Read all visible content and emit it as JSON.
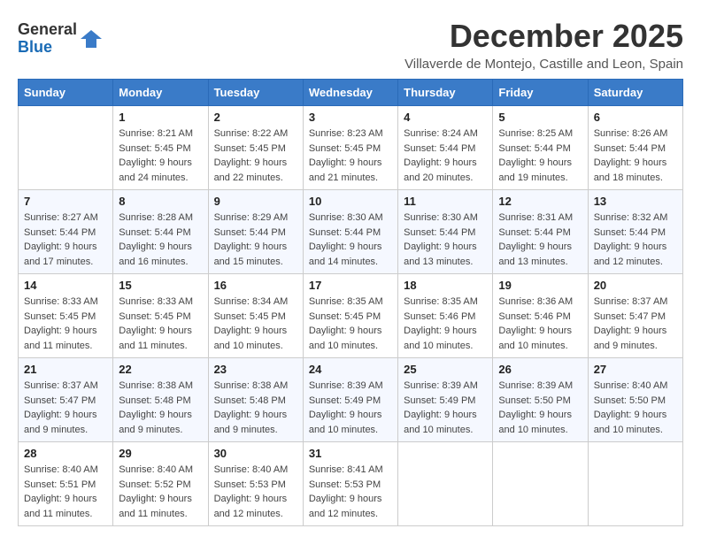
{
  "logo": {
    "general": "General",
    "blue": "Blue"
  },
  "title": "December 2025",
  "location": "Villaverde de Montejo, Castille and Leon, Spain",
  "weekdays": [
    "Sunday",
    "Monday",
    "Tuesday",
    "Wednesday",
    "Thursday",
    "Friday",
    "Saturday"
  ],
  "weeks": [
    [
      {
        "day": "",
        "sunrise": "",
        "sunset": "",
        "daylight": ""
      },
      {
        "day": "1",
        "sunrise": "Sunrise: 8:21 AM",
        "sunset": "Sunset: 5:45 PM",
        "daylight": "Daylight: 9 hours and 24 minutes."
      },
      {
        "day": "2",
        "sunrise": "Sunrise: 8:22 AM",
        "sunset": "Sunset: 5:45 PM",
        "daylight": "Daylight: 9 hours and 22 minutes."
      },
      {
        "day": "3",
        "sunrise": "Sunrise: 8:23 AM",
        "sunset": "Sunset: 5:45 PM",
        "daylight": "Daylight: 9 hours and 21 minutes."
      },
      {
        "day": "4",
        "sunrise": "Sunrise: 8:24 AM",
        "sunset": "Sunset: 5:44 PM",
        "daylight": "Daylight: 9 hours and 20 minutes."
      },
      {
        "day": "5",
        "sunrise": "Sunrise: 8:25 AM",
        "sunset": "Sunset: 5:44 PM",
        "daylight": "Daylight: 9 hours and 19 minutes."
      },
      {
        "day": "6",
        "sunrise": "Sunrise: 8:26 AM",
        "sunset": "Sunset: 5:44 PM",
        "daylight": "Daylight: 9 hours and 18 minutes."
      }
    ],
    [
      {
        "day": "7",
        "sunrise": "Sunrise: 8:27 AM",
        "sunset": "Sunset: 5:44 PM",
        "daylight": "Daylight: 9 hours and 17 minutes."
      },
      {
        "day": "8",
        "sunrise": "Sunrise: 8:28 AM",
        "sunset": "Sunset: 5:44 PM",
        "daylight": "Daylight: 9 hours and 16 minutes."
      },
      {
        "day": "9",
        "sunrise": "Sunrise: 8:29 AM",
        "sunset": "Sunset: 5:44 PM",
        "daylight": "Daylight: 9 hours and 15 minutes."
      },
      {
        "day": "10",
        "sunrise": "Sunrise: 8:30 AM",
        "sunset": "Sunset: 5:44 PM",
        "daylight": "Daylight: 9 hours and 14 minutes."
      },
      {
        "day": "11",
        "sunrise": "Sunrise: 8:30 AM",
        "sunset": "Sunset: 5:44 PM",
        "daylight": "Daylight: 9 hours and 13 minutes."
      },
      {
        "day": "12",
        "sunrise": "Sunrise: 8:31 AM",
        "sunset": "Sunset: 5:44 PM",
        "daylight": "Daylight: 9 hours and 13 minutes."
      },
      {
        "day": "13",
        "sunrise": "Sunrise: 8:32 AM",
        "sunset": "Sunset: 5:44 PM",
        "daylight": "Daylight: 9 hours and 12 minutes."
      }
    ],
    [
      {
        "day": "14",
        "sunrise": "Sunrise: 8:33 AM",
        "sunset": "Sunset: 5:45 PM",
        "daylight": "Daylight: 9 hours and 11 minutes."
      },
      {
        "day": "15",
        "sunrise": "Sunrise: 8:33 AM",
        "sunset": "Sunset: 5:45 PM",
        "daylight": "Daylight: 9 hours and 11 minutes."
      },
      {
        "day": "16",
        "sunrise": "Sunrise: 8:34 AM",
        "sunset": "Sunset: 5:45 PM",
        "daylight": "Daylight: 9 hours and 10 minutes."
      },
      {
        "day": "17",
        "sunrise": "Sunrise: 8:35 AM",
        "sunset": "Sunset: 5:45 PM",
        "daylight": "Daylight: 9 hours and 10 minutes."
      },
      {
        "day": "18",
        "sunrise": "Sunrise: 8:35 AM",
        "sunset": "Sunset: 5:46 PM",
        "daylight": "Daylight: 9 hours and 10 minutes."
      },
      {
        "day": "19",
        "sunrise": "Sunrise: 8:36 AM",
        "sunset": "Sunset: 5:46 PM",
        "daylight": "Daylight: 9 hours and 10 minutes."
      },
      {
        "day": "20",
        "sunrise": "Sunrise: 8:37 AM",
        "sunset": "Sunset: 5:47 PM",
        "daylight": "Daylight: 9 hours and 9 minutes."
      }
    ],
    [
      {
        "day": "21",
        "sunrise": "Sunrise: 8:37 AM",
        "sunset": "Sunset: 5:47 PM",
        "daylight": "Daylight: 9 hours and 9 minutes."
      },
      {
        "day": "22",
        "sunrise": "Sunrise: 8:38 AM",
        "sunset": "Sunset: 5:48 PM",
        "daylight": "Daylight: 9 hours and 9 minutes."
      },
      {
        "day": "23",
        "sunrise": "Sunrise: 8:38 AM",
        "sunset": "Sunset: 5:48 PM",
        "daylight": "Daylight: 9 hours and 9 minutes."
      },
      {
        "day": "24",
        "sunrise": "Sunrise: 8:39 AM",
        "sunset": "Sunset: 5:49 PM",
        "daylight": "Daylight: 9 hours and 10 minutes."
      },
      {
        "day": "25",
        "sunrise": "Sunrise: 8:39 AM",
        "sunset": "Sunset: 5:49 PM",
        "daylight": "Daylight: 9 hours and 10 minutes."
      },
      {
        "day": "26",
        "sunrise": "Sunrise: 8:39 AM",
        "sunset": "Sunset: 5:50 PM",
        "daylight": "Daylight: 9 hours and 10 minutes."
      },
      {
        "day": "27",
        "sunrise": "Sunrise: 8:40 AM",
        "sunset": "Sunset: 5:50 PM",
        "daylight": "Daylight: 9 hours and 10 minutes."
      }
    ],
    [
      {
        "day": "28",
        "sunrise": "Sunrise: 8:40 AM",
        "sunset": "Sunset: 5:51 PM",
        "daylight": "Daylight: 9 hours and 11 minutes."
      },
      {
        "day": "29",
        "sunrise": "Sunrise: 8:40 AM",
        "sunset": "Sunset: 5:52 PM",
        "daylight": "Daylight: 9 hours and 11 minutes."
      },
      {
        "day": "30",
        "sunrise": "Sunrise: 8:40 AM",
        "sunset": "Sunset: 5:53 PM",
        "daylight": "Daylight: 9 hours and 12 minutes."
      },
      {
        "day": "31",
        "sunrise": "Sunrise: 8:41 AM",
        "sunset": "Sunset: 5:53 PM",
        "daylight": "Daylight: 9 hours and 12 minutes."
      },
      {
        "day": "",
        "sunrise": "",
        "sunset": "",
        "daylight": ""
      },
      {
        "day": "",
        "sunrise": "",
        "sunset": "",
        "daylight": ""
      },
      {
        "day": "",
        "sunrise": "",
        "sunset": "",
        "daylight": ""
      }
    ]
  ]
}
